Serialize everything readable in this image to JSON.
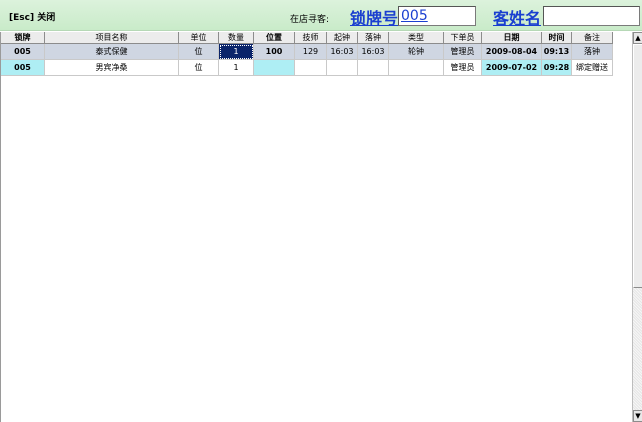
{
  "toolbar": {
    "close_label": "[Esc] 关闭",
    "in_store_label": "在店寻客:",
    "lock_label": "锁牌号",
    "lock_value": "005",
    "customer_label": "客姓名",
    "customer_value": ""
  },
  "table": {
    "headers": [
      "锁牌",
      "项目名称",
      "单位",
      "数量",
      "位置",
      "技师",
      "起钟",
      "落钟",
      "类型",
      "下单员",
      "日期",
      "时间",
      "备注"
    ],
    "rows": [
      [
        "005",
        "泰式保健",
        "位",
        "1",
        "100",
        "129",
        "16:03",
        "16:03",
        "轮钟",
        "管理员",
        "2009-08-04",
        "09:13",
        "落钟"
      ],
      [
        "005",
        "男宾净桑",
        "位",
        "1",
        "",
        "",
        "",
        "",
        "",
        "管理员",
        "2009-07-02",
        "09:28",
        "绑定赠送"
      ]
    ]
  },
  "scrollbar": {
    "up_icon": "▲",
    "down_icon": "▼"
  }
}
